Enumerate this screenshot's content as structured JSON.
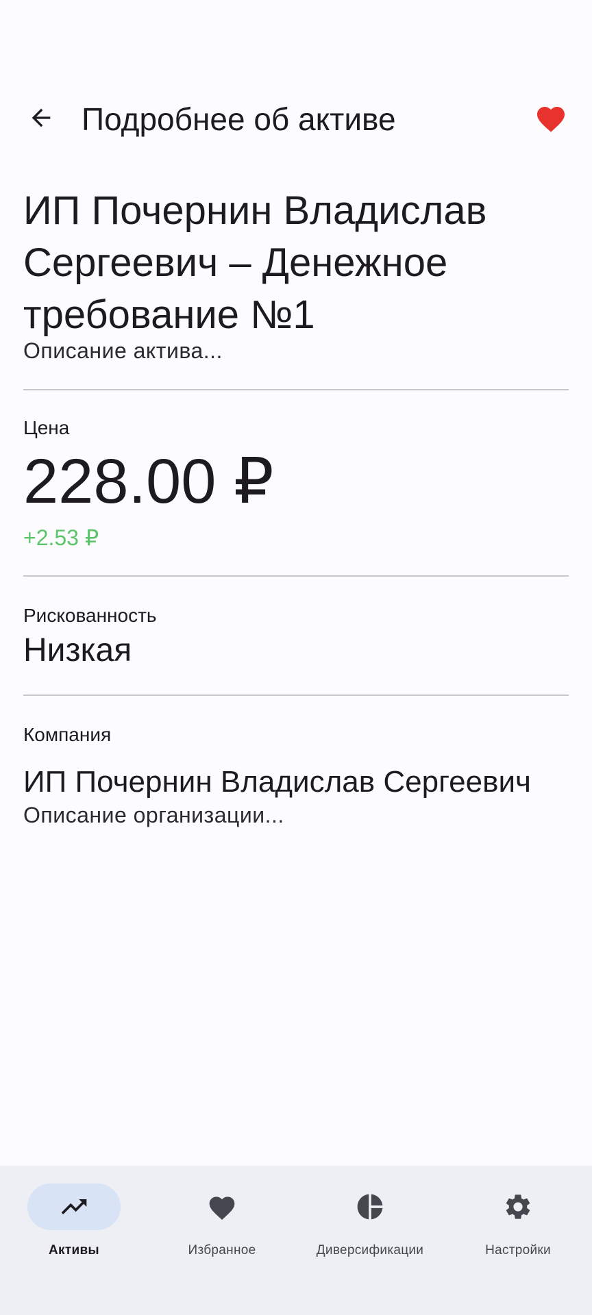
{
  "app_bar": {
    "title": "Подробнее об активе",
    "back_icon": "arrow-left-icon",
    "favorite_icon": "heart-filled-icon",
    "favorite_color": "#e8322d"
  },
  "asset": {
    "name": "ИП Почернин Владислав Сергеевич – Денежное требование №1",
    "description": "Описание актива..."
  },
  "price": {
    "label": "Цена",
    "value": "228.00 ₽",
    "change": "+2.53 ₽",
    "change_color": "#5cc46a"
  },
  "risk": {
    "label": "Рискованность",
    "value": "Низкая"
  },
  "company": {
    "label": "Компания",
    "name": "ИП Почернин Владислав Сергеевич",
    "description": "Описание организации..."
  },
  "bottom_nav": {
    "items": [
      {
        "label": "Активы",
        "icon": "trending-up-icon",
        "active": true
      },
      {
        "label": "Избранное",
        "icon": "heart-icon",
        "active": false
      },
      {
        "label": "Диверсификации",
        "icon": "pie-chart-icon",
        "active": false
      },
      {
        "label": "Настройки",
        "icon": "gear-icon",
        "active": false
      }
    ],
    "active_indicator_color": "#d8e3f5"
  }
}
